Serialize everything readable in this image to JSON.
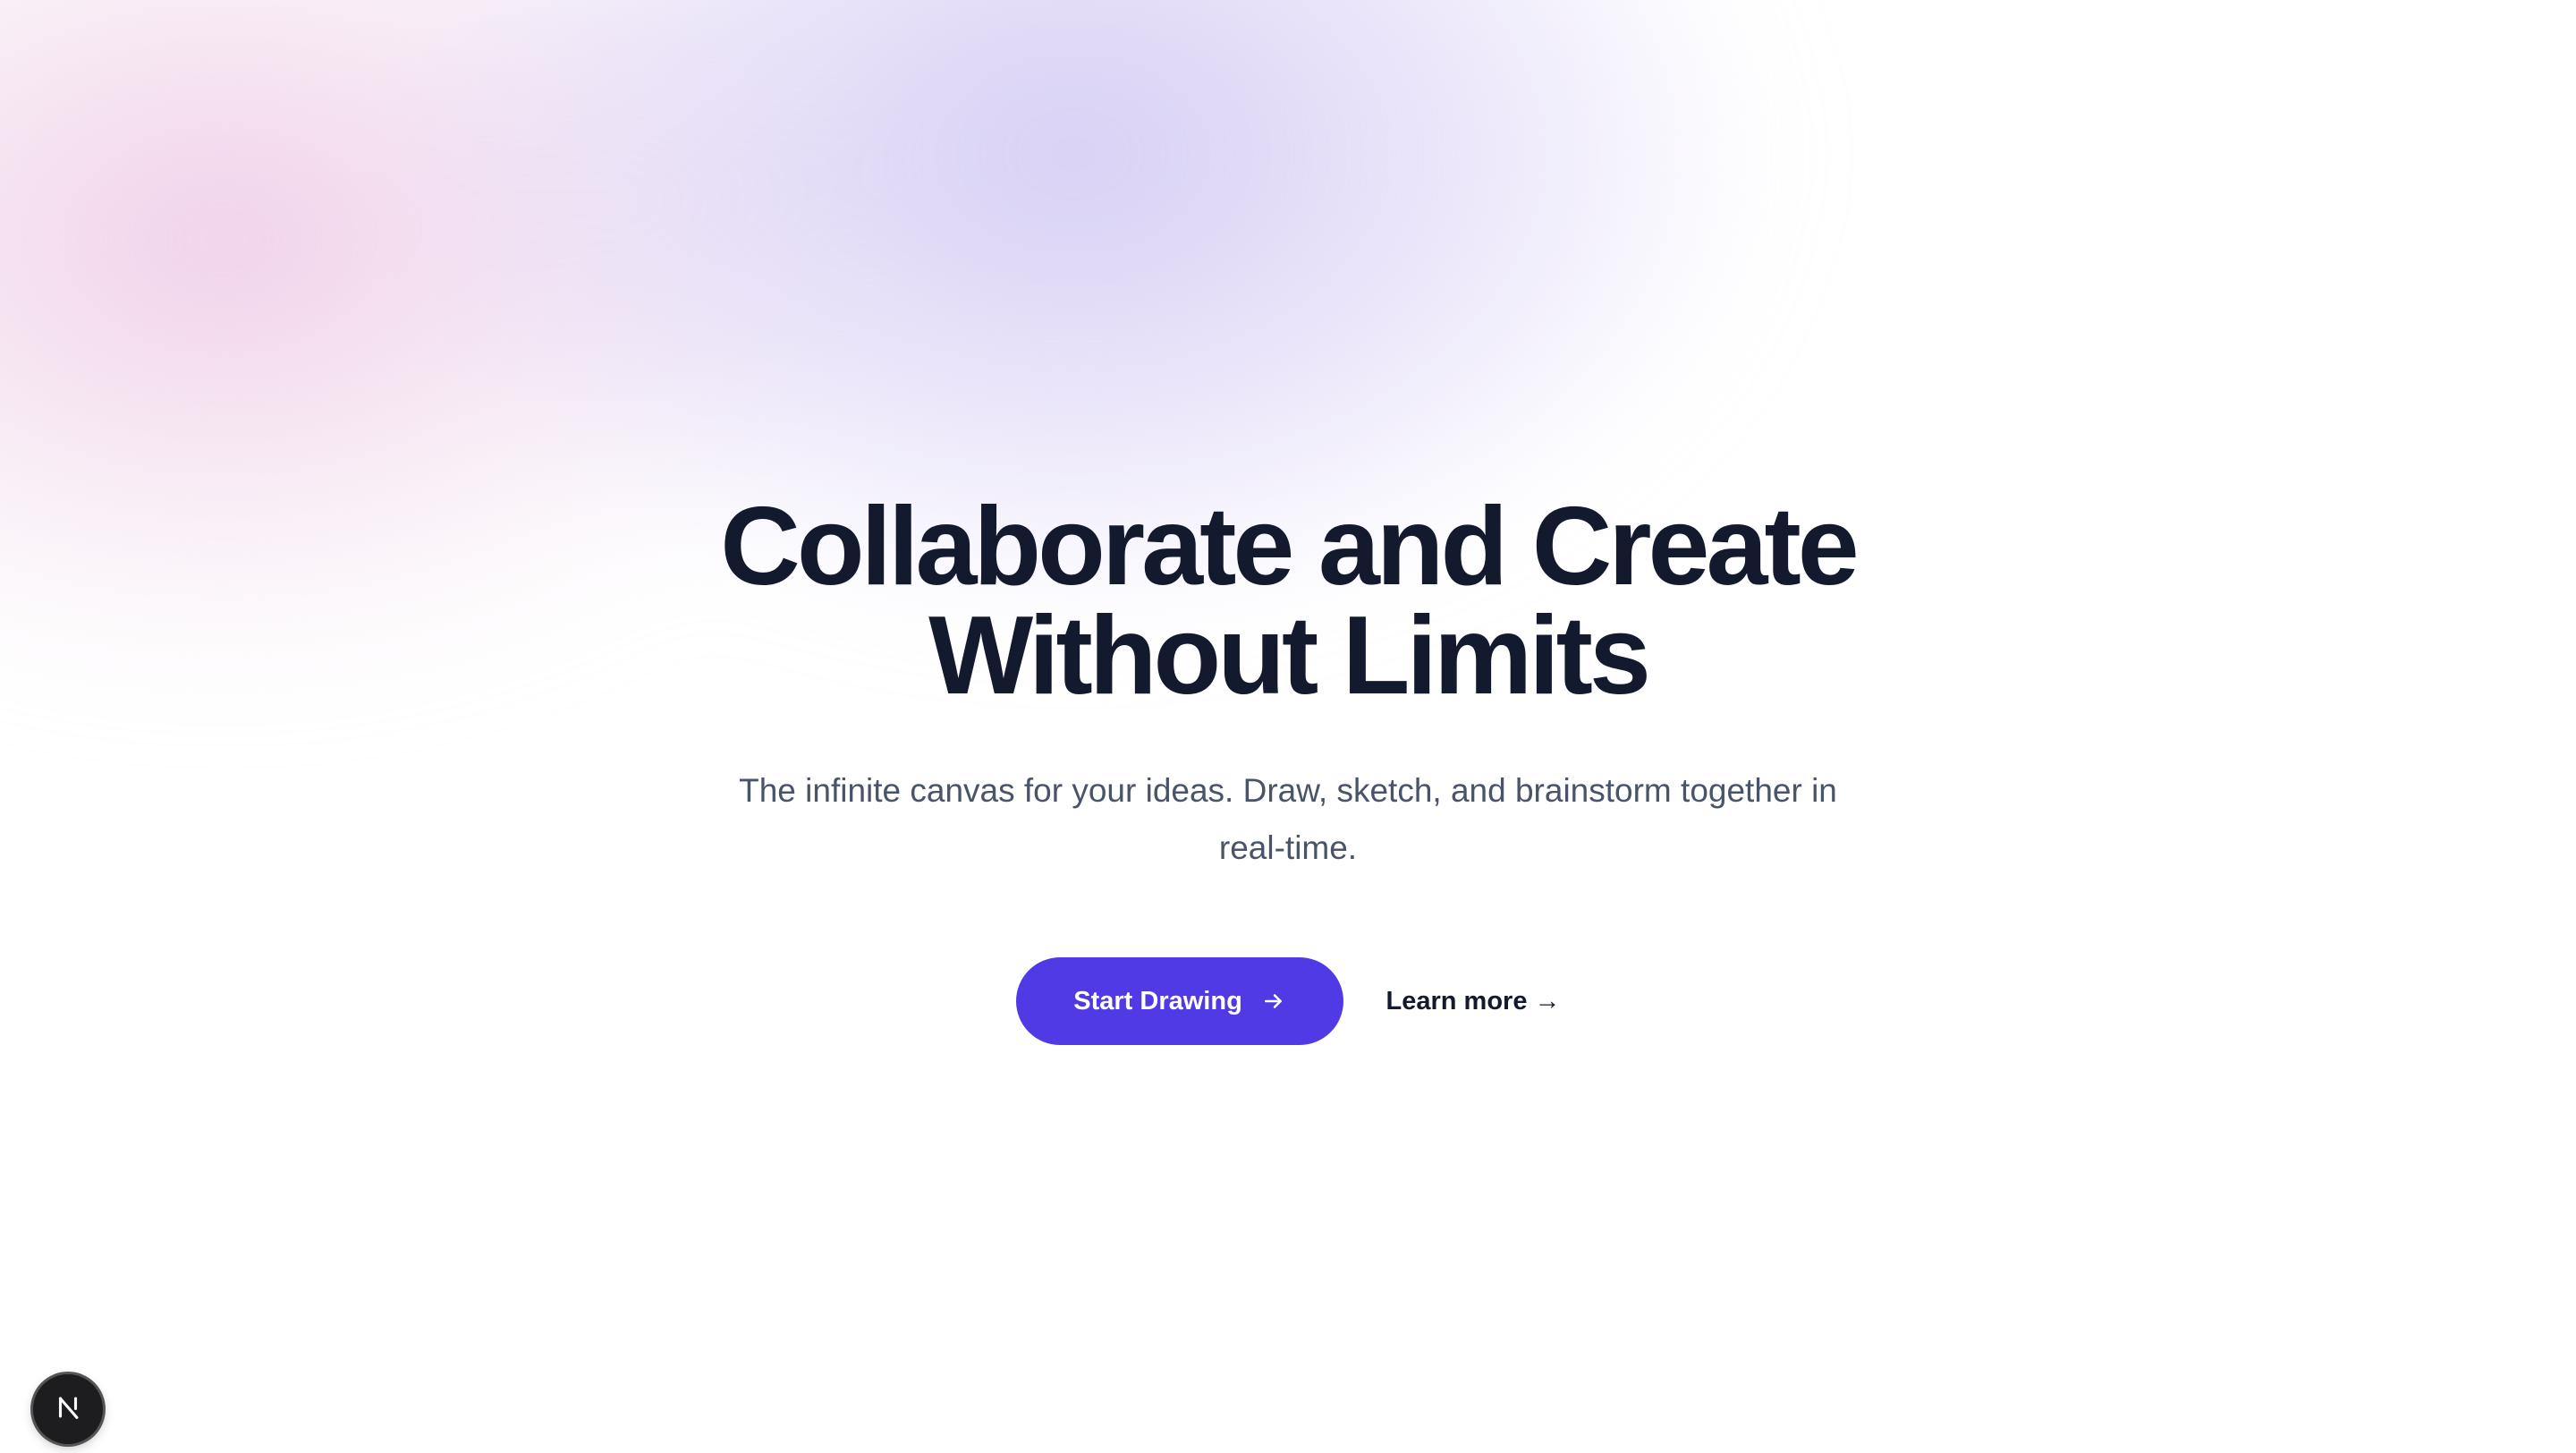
{
  "hero": {
    "title_line1": "Collaborate and Create",
    "title_line2": "Without Limits",
    "subtitle": "The infinite canvas for your ideas. Draw, sketch, and brainstorm together in real-time."
  },
  "cta": {
    "primary_label": "Start Drawing",
    "primary_icon": "arrow-right-icon",
    "secondary_label": "Learn more",
    "secondary_arrow": "→"
  },
  "badge": {
    "icon": "nextjs-logo-icon"
  },
  "colors": {
    "primary": "#4f3ae6",
    "title": "#141a2e",
    "subtitle": "#4a5468",
    "glow_violet": "#c8bef0",
    "glow_pink": "#eec8e4",
    "badge_bg": "#1d1d1f"
  }
}
